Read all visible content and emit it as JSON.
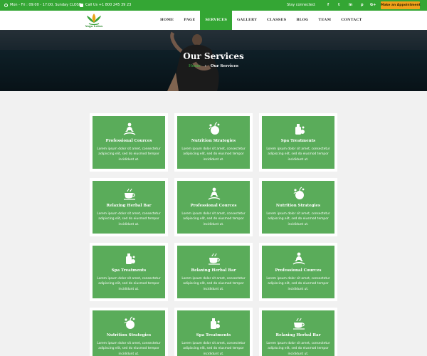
{
  "topbar": {
    "hours": "Mon - Fri : 09:00 - 17:00, Sunday CLOSE",
    "phone": "Call Us +1 800 245 39 23",
    "stay_connected": "Stay connected:",
    "social": [
      "f",
      "t",
      "in",
      "p",
      "G+"
    ],
    "appointment": "Make an Appointment"
  },
  "logo": {
    "text": "Yoga Lotus"
  },
  "nav": [
    "HOME",
    "PAGE",
    "SERVICES",
    "GALLERY",
    "CLASSES",
    "BLOG",
    "TEAM",
    "CONTACT"
  ],
  "hero": {
    "title": "Our Services",
    "crumb_home": "Home",
    "crumb_sep": "›",
    "crumb_current": "Our Services"
  },
  "services": [
    {
      "title": "Professional Cources",
      "icon": "meditation-icon",
      "text": "Lorem ipsum dolor sit amet, consectetur adipiscing elit, sed do eiusmod tempor incididunt ut."
    },
    {
      "title": "Nutrition Strategies",
      "icon": "apple-icon",
      "text": "Lorem ipsum dolor sit amet, consectetur adipiscing elit, sed do eiusmod tempor incididunt ut."
    },
    {
      "title": "Spa Treatments",
      "icon": "spa-bottle-icon",
      "text": "Lorem ipsum dolor sit amet, consectetur adipiscing elit, sed do eiusmod tempor incididunt ut."
    },
    {
      "title": "Relaxing Herbal Bar",
      "icon": "tea-cup-icon",
      "text": "Lorem ipsum dolor sit amet, consectetur adipiscing elit, sed do eiusmod tempor incididunt ut."
    },
    {
      "title": "Professional Cources",
      "icon": "meditation-icon",
      "text": "Lorem ipsum dolor sit amet, consectetur adipiscing elit, sed do eiusmod tempor incididunt ut."
    },
    {
      "title": "Nutrition Strategies",
      "icon": "apple-icon",
      "text": "Lorem ipsum dolor sit amet, consectetur adipiscing elit, sed do eiusmod tempor incididunt ut."
    },
    {
      "title": "Spa Treatments",
      "icon": "spa-bottle-icon",
      "text": "Lorem ipsum dolor sit amet, consectetur adipiscing elit, sed do eiusmod tempor incididunt ut."
    },
    {
      "title": "Relaxing Herbal Bar",
      "icon": "tea-cup-icon",
      "text": "Lorem ipsum dolor sit amet, consectetur adipiscing elit, sed do eiusmod tempor incididunt ut."
    },
    {
      "title": "Professional Cources",
      "icon": "meditation-icon",
      "text": "Lorem ipsum dolor sit amet, consectetur adipiscing elit, sed do eiusmod tempor incididunt ut."
    },
    {
      "title": "Nutrition Strategies",
      "icon": "apple-icon",
      "text": "Lorem ipsum dolor sit amet, consectetur adipiscing elit, sed do eiusmod tempor incididunt ut."
    },
    {
      "title": "Spa Treatments",
      "icon": "spa-bottle-icon",
      "text": "Lorem ipsum dolor sit amet, consectetur adipiscing elit, sed do eiusmod tempor incididunt ut."
    },
    {
      "title": "Relaxing Herbal Bar",
      "icon": "tea-cup-icon",
      "text": "Lorem ipsum dolor sit amet, consectetur adipiscing elit, sed do eiusmod tempor incididunt ut."
    }
  ],
  "colors": {
    "accent": "#34a634",
    "card": "#5aac5a",
    "appointment": "#f1a21b"
  }
}
